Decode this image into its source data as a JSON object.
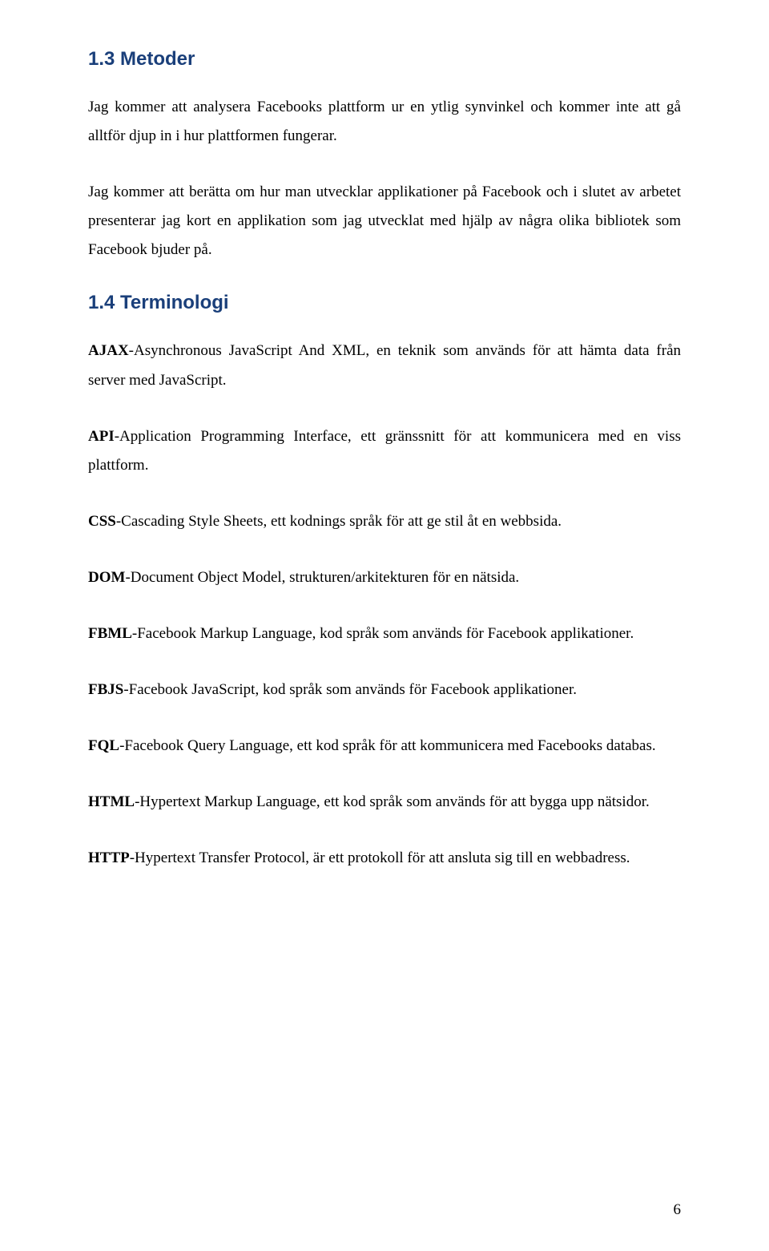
{
  "sections": {
    "metoder": {
      "heading": "1.3  Metoder",
      "p1": "Jag kommer att analysera Facebooks plattform ur en ytlig synvinkel och kommer inte att gå alltför djup in i hur plattformen fungerar.",
      "p2": "Jag kommer att berätta om hur man utvecklar applikationer på Facebook och i slutet av arbetet presenterar jag kort en applikation som jag utvecklat med hjälp av några olika bibliotek som Facebook bjuder på."
    },
    "terminologi": {
      "heading": "1.4  Terminologi",
      "terms": [
        {
          "bold": "AJAX",
          "rest": "-Asynchronous JavaScript And XML, en teknik som används för att hämta data från server med JavaScript."
        },
        {
          "bold": "API",
          "rest": "-Application Programming Interface, ett gränssnitt för att kommunicera med en viss plattform."
        },
        {
          "bold": "CSS",
          "rest": "-Cascading Style Sheets, ett kodnings språk för att ge stil åt en webbsida."
        },
        {
          "bold": "DOM",
          "rest": "-Document Object Model, strukturen/arkitekturen för en nätsida."
        },
        {
          "bold": "FBML",
          "rest": "-Facebook Markup Language, kod språk som används för Facebook applikationer."
        },
        {
          "bold": "FBJS",
          "rest": "-Facebook JavaScript, kod språk som används för Facebook applikationer."
        },
        {
          "bold": "FQL",
          "rest": "-Facebook Query Language, ett kod språk för att kommunicera med Facebooks databas."
        },
        {
          "bold": "HTML",
          "rest": "-Hypertext Markup Language, ett kod språk som används för att bygga upp nätsidor."
        },
        {
          "bold": "HTTP",
          "rest": "-Hypertext Transfer Protocol, är ett protokoll för att ansluta sig till en webbadress."
        }
      ]
    }
  },
  "pageNumber": "6"
}
